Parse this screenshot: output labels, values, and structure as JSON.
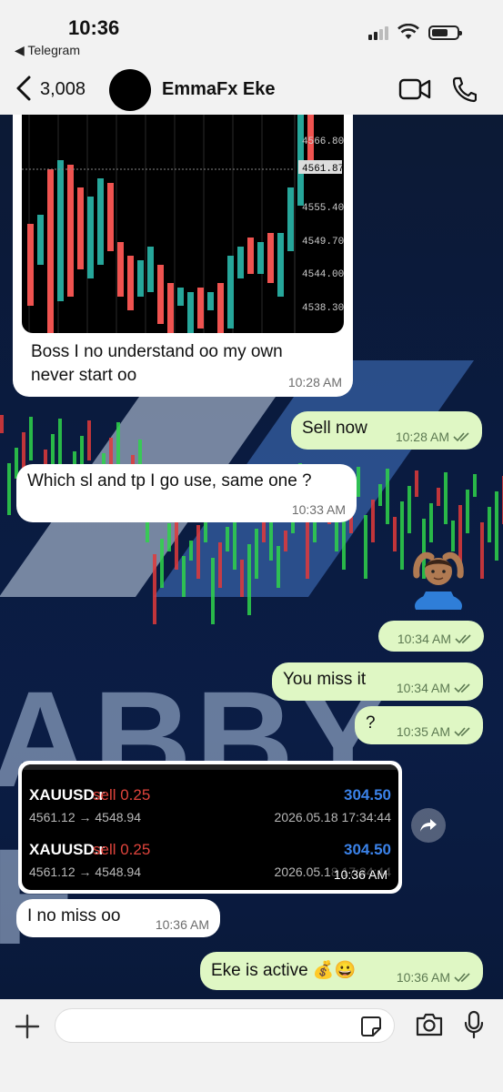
{
  "status": {
    "time": "10:36",
    "back_app": "◀ Telegram"
  },
  "header": {
    "back_count": "3,008",
    "name": "EmmaFx Eke"
  },
  "chart_image": {
    "price_labels": [
      "4566.80",
      "4561.87",
      "4555.40",
      "4549.70",
      "4544.00",
      "4538.30"
    ],
    "current_price": "4561.87"
  },
  "messages": [
    {
      "id": "m1",
      "dir": "in",
      "text": "Boss I no understand oo my own never start oo",
      "line1": "Boss I no understand oo my own",
      "line2": "never start oo",
      "time": "10:28 AM"
    },
    {
      "id": "m2",
      "dir": "out",
      "text": "Sell now",
      "time": "10:28 AM"
    },
    {
      "id": "m3",
      "dir": "in",
      "text": "Which sl and tp I go use, same one ?",
      "time": "10:33 AM"
    },
    {
      "id": "m4",
      "dir": "out",
      "text": "🙆🏽‍♂️",
      "time": "10:34 AM"
    },
    {
      "id": "m5",
      "dir": "out",
      "text": "You miss it",
      "time": "10:34 AM"
    },
    {
      "id": "m6",
      "dir": "out",
      "text": "?",
      "time": "10:35 AM"
    },
    {
      "id": "m7",
      "dir": "in",
      "text": "I no miss oo",
      "time": "10:36 AM"
    },
    {
      "id": "m8",
      "dir": "out",
      "text": "Eke is active 💰😀",
      "time": "10:36 AM"
    }
  ],
  "trade_image": {
    "time": "10:36 AM",
    "trades": [
      {
        "symbol": "XAUUSD.r",
        "side": "sell 0.25",
        "profit": "304.50",
        "prices": "4561.12 → 4548.94",
        "date": "2026.05.18 17:34:44"
      },
      {
        "symbol": "XAUUSD.r",
        "side": "sell 0.25",
        "profit": "304.50",
        "prices": "4561.12 → 4548.94",
        "date": "2026.05.18 17:34:44"
      }
    ]
  },
  "composer": {
    "placeholder": ""
  },
  "colors": {
    "incoming": "#ffffff",
    "outgoing": "#dff7c4",
    "bull": "#26a69a",
    "bear": "#ef5350"
  }
}
